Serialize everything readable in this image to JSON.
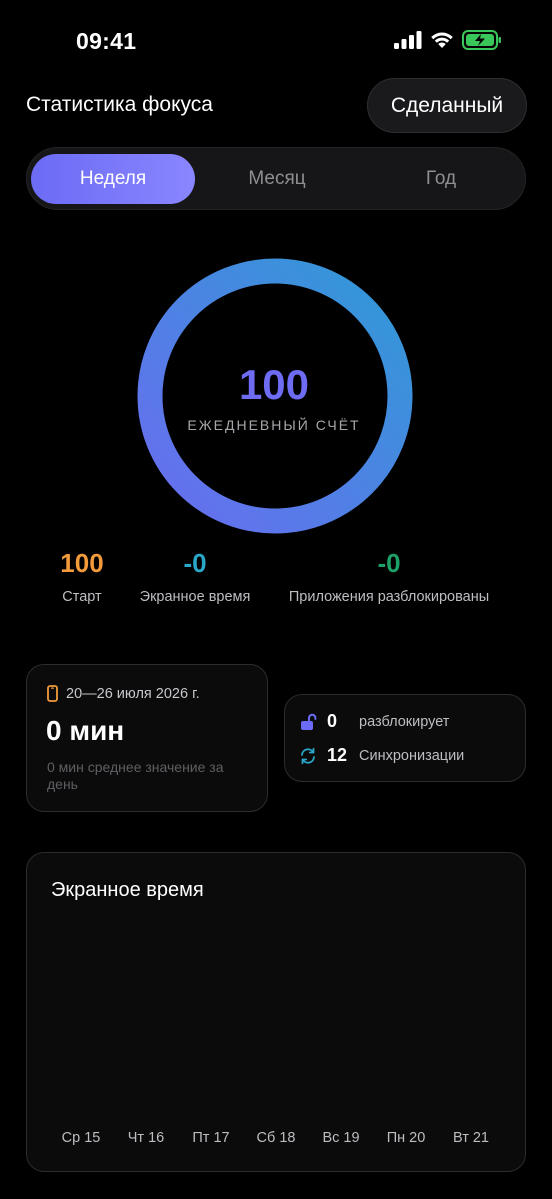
{
  "status": {
    "time": "09:41",
    "icons": [
      "signal-icon",
      "wifi-icon",
      "battery-charging-icon"
    ]
  },
  "header": {
    "title": "Статистика фокуса",
    "done_label": "Сделанный"
  },
  "tabs": [
    {
      "label": "Неделя",
      "active": true
    },
    {
      "label": "Месяц",
      "active": false
    },
    {
      "label": "Год",
      "active": false
    }
  ],
  "score": {
    "value": "100",
    "label": "ЕЖЕДНЕВНЫЙ СЧЁТ",
    "progress": 1.0
  },
  "stats": [
    {
      "value": "100",
      "label": "Старт",
      "color": "#f39a3b"
    },
    {
      "value": "-0",
      "label": "Экранное время",
      "color": "#2aa7c9"
    },
    {
      "value": "-0",
      "label": "Приложения разблокированы",
      "color": "#1e9f68"
    }
  ],
  "summary": {
    "date_range": "20—26 июля 2026 г.",
    "total": "0 мин",
    "average": "0 мин среднее значение за день"
  },
  "counters": [
    {
      "value": "0",
      "label": "разблокирует",
      "icon": "unlock-icon"
    },
    {
      "value": "12",
      "label": "Синхронизации",
      "icon": "sync-icon"
    }
  ],
  "chart": {
    "title": "Экранное время"
  },
  "chart_data": {
    "type": "bar",
    "title": "Экранное время",
    "categories": [
      "Ср 15",
      "Чт 16",
      "Пт 17",
      "Сб 18",
      "Вс 19",
      "Пн 20",
      "Вт 21"
    ],
    "values": [
      0,
      0,
      0,
      0,
      0,
      0,
      0
    ]
  },
  "colors": {
    "accent": "#6b6bf5",
    "ring_start": "#6a6cf0",
    "ring_end": "#2f9ad6"
  }
}
